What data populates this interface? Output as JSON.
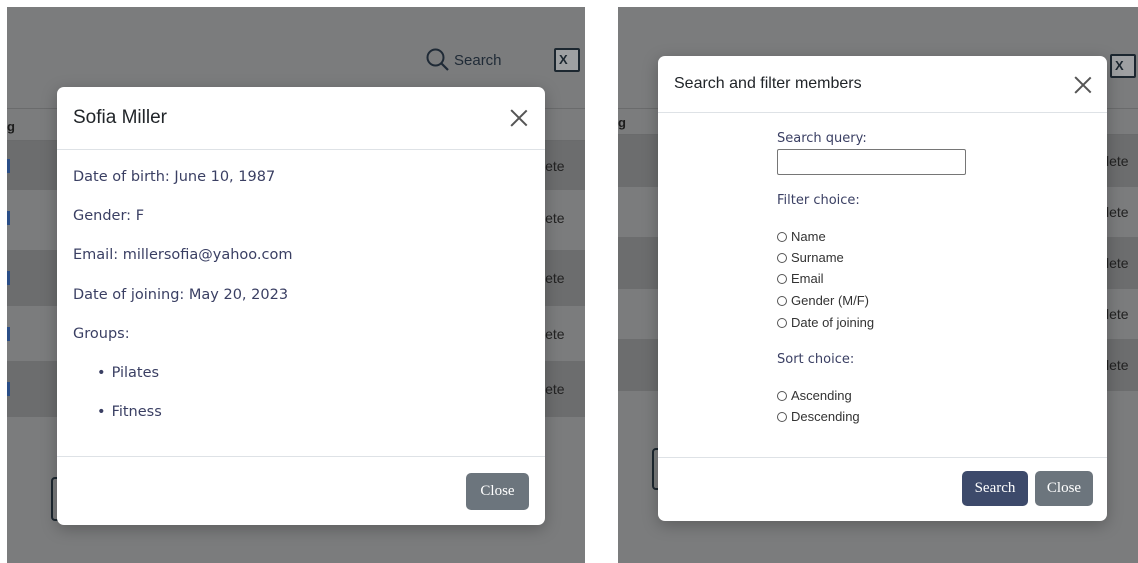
{
  "background_left": {
    "search_label": "Search",
    "search_icon": "magnifier-icon",
    "excel_icon": "excel-export-icon",
    "excel_glyph": "X",
    "header_fragment": "g",
    "row_delete_fragment": "lete"
  },
  "background_right": {
    "header_fragment": "g",
    "excel_glyph": "X",
    "row_delete_fragment": "lete"
  },
  "member_modal": {
    "title": "Sofia Miller",
    "close_icon": "close-icon",
    "dob_label": "Date of birth:",
    "dob_value": "June 10, 1987",
    "gender_label": "Gender:",
    "gender_value": "F",
    "email_label": "Email:",
    "email_value": "millersofia@yahoo.com",
    "joining_label": "Date of joining:",
    "joining_value": "May 20, 2023",
    "groups_label": "Groups:",
    "groups": [
      "Pilates",
      "Fitness"
    ],
    "close_button": "Close"
  },
  "search_modal": {
    "title": "Search and filter members",
    "close_icon": "close-icon",
    "query_label": "Search query:",
    "query_value": "",
    "filter_label": "Filter choice:",
    "filter_options": [
      "Name",
      "Surname",
      "Email",
      "Gender (M/F)",
      "Date of joining"
    ],
    "sort_label": "Sort choice:",
    "sort_options": [
      "Ascending",
      "Descending"
    ],
    "search_button": "Search",
    "close_button": "Close"
  },
  "colors": {
    "overlay": "#7b7c7d",
    "primary_button": "#3d4a6b",
    "secondary_button": "#6c757d",
    "body_text": "#3a3f63"
  }
}
